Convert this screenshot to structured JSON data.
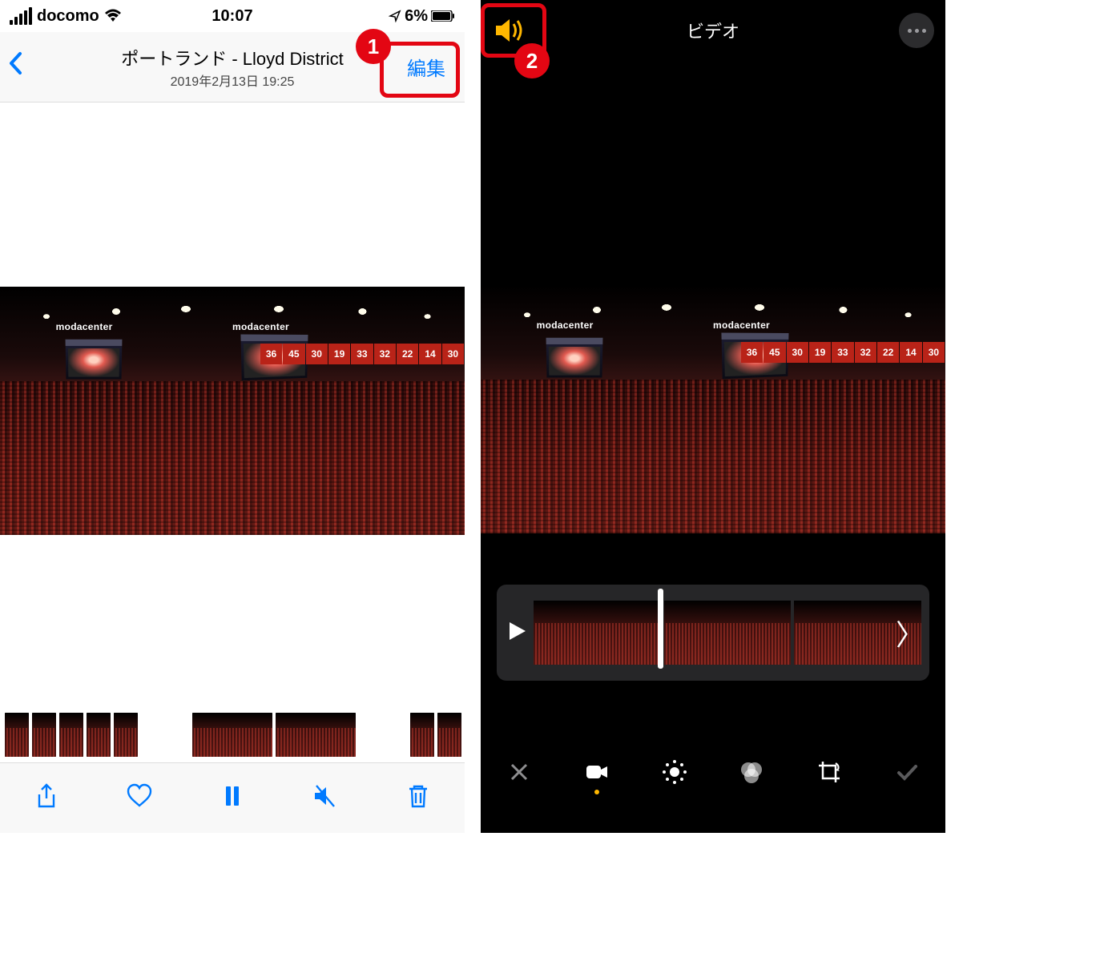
{
  "status": {
    "carrier": "docomo",
    "time": "10:07",
    "battery": "6%"
  },
  "header": {
    "title": "ポートランド - Lloyd District",
    "subtitle": "2019年2月13日 19:25",
    "edit_label": "編集"
  },
  "edit_screen": {
    "title": "ビデオ"
  },
  "arena": {
    "venue_label": "modacenter",
    "ring_numbers": [
      "36",
      "45",
      "30",
      "19",
      "33",
      "32",
      "22",
      "14",
      "30"
    ]
  },
  "annotations": {
    "one": "1",
    "two": "2"
  },
  "tool_icons": {
    "share": "share-icon",
    "heart": "heart-icon",
    "pause": "pause-icon",
    "mute": "mute-icon",
    "trash": "trash-icon",
    "sound": "sound-icon",
    "more": "more-icon",
    "close": "close-icon",
    "video": "video-icon",
    "adjust": "adjust-icon",
    "filters": "filters-icon",
    "crop": "crop-icon",
    "check": "check-icon",
    "play": "play-icon"
  }
}
